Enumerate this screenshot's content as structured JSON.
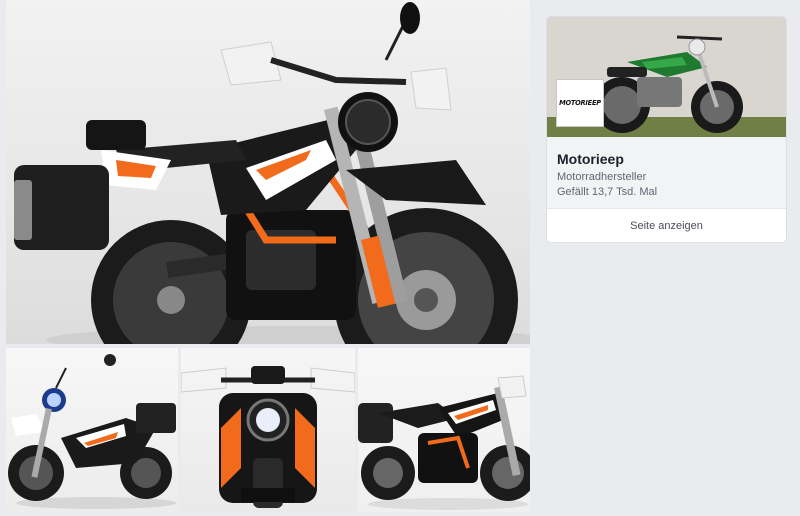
{
  "gallery": {
    "photos": [
      {
        "alt": "motorcycle-main-side-view"
      },
      {
        "alt": "motorcycle-front-three-quarter"
      },
      {
        "alt": "motorcycle-front-view"
      },
      {
        "alt": "motorcycle-rear-three-quarter"
      }
    ]
  },
  "page_card": {
    "logo_text": "MOTORIEEP",
    "name": "Motorieep",
    "category": "Motorradhersteller",
    "likes": "Gefällt 13,7 Tsd. Mal",
    "button_label": "Seite anzeigen"
  },
  "colors": {
    "background": "#e9ebee",
    "accent_orange": "#f26a1b",
    "text_primary": "#1d2129",
    "text_secondary": "#606770"
  }
}
